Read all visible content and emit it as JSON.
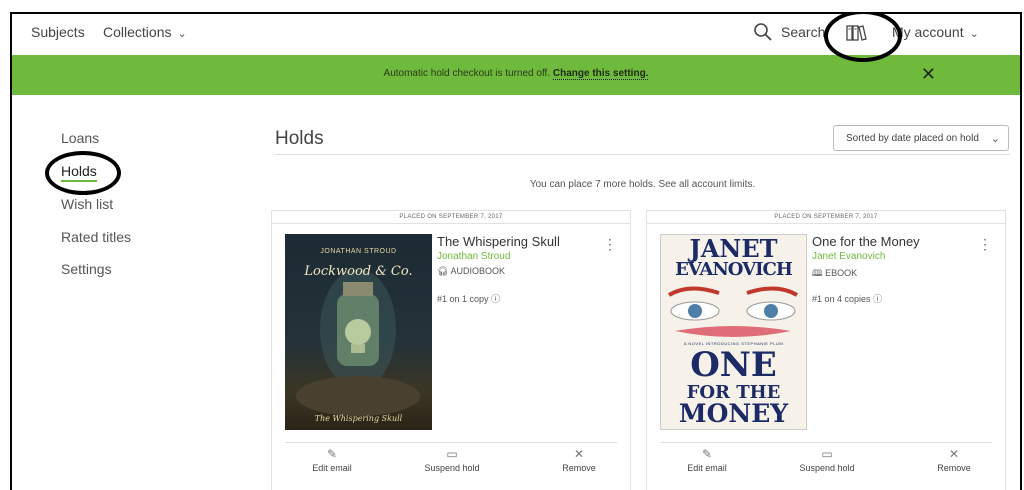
{
  "topbar": {
    "subjects": "Subjects",
    "collections": "Collections",
    "search": "Search",
    "my_account": "My account"
  },
  "banner": {
    "text": "Automatic hold checkout is turned off.",
    "link": "Change this setting.",
    "background": "#6fba3c"
  },
  "sidebar": {
    "items": [
      {
        "label": "Loans"
      },
      {
        "label": "Holds"
      },
      {
        "label": "Wish list"
      },
      {
        "label": "Rated titles"
      },
      {
        "label": "Settings"
      }
    ]
  },
  "main": {
    "title": "Holds",
    "sort_label": "Sorted by date placed on hold",
    "limit_text": "You can place 7 more holds.",
    "limit_link": "See all account limits."
  },
  "holds": [
    {
      "placed": "PLACED ON SEPTEMBER 7, 2017",
      "title": "The Whispering Skull",
      "author": "Jonathan Stroud",
      "format": "AUDIOBOOK",
      "rank": "#1 on 1 copy",
      "cover": {
        "top": "JONATHAN STROUD",
        "main": "Lockwood & Co.",
        "bottom": "The Whispering Skull"
      }
    },
    {
      "placed": "PLACED ON SEPTEMBER 7, 2017",
      "title": "One for the Money",
      "author": "Janet Evanovich",
      "format": "EBOOK",
      "rank": "#1 on 4 copies",
      "cover": {
        "line1": "JANET",
        "line2": "EVANOVICH",
        "line3": "ONE",
        "line4": "FOR THE",
        "line5": "MONEY",
        "tagline": "A NOVEL INTRODUCING STEPHANIE PLUM"
      }
    }
  ],
  "actions": {
    "edit_email": "Edit email",
    "suspend_hold": "Suspend hold",
    "remove": "Remove"
  },
  "colors": {
    "accent": "#6fba3c",
    "author": "#6fba3c"
  }
}
